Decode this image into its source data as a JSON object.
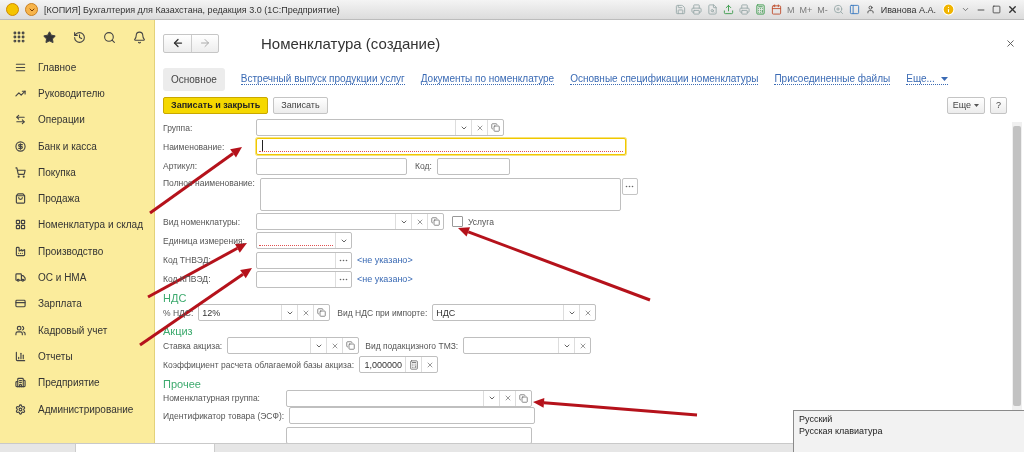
{
  "window": {
    "title": "[КОПИЯ] Бухгалтерия для Казахстана, редакция 3.0  (1С:Предприятие)",
    "memory_buttons": [
      "M",
      "M+",
      "M-"
    ],
    "user": "Иванова А.А."
  },
  "sidebar": {
    "items": [
      "Главное",
      "Руководителю",
      "Операции",
      "Банк и касса",
      "Покупка",
      "Продажа",
      "Номенклатура и склад",
      "Производство",
      "ОС и НМА",
      "Зарплата",
      "Кадровый учет",
      "Отчеты",
      "Предприятие",
      "Администрирование"
    ]
  },
  "form": {
    "title": "Номенклатура (создание)",
    "tabs": [
      {
        "label": "Основное",
        "selected": true
      },
      {
        "label": "Встречный выпуск продукции услуг",
        "selected": false
      },
      {
        "label": "Документы по номенклатуре",
        "selected": false
      },
      {
        "label": "Основные спецификации номенклатуры",
        "selected": false
      },
      {
        "label": "Присоединенные файлы",
        "selected": false
      }
    ],
    "tabs_more": "Еще...",
    "buttons": [
      {
        "label": "Записать и закрыть",
        "default": true
      },
      {
        "label": "Записать",
        "default": false
      }
    ],
    "more_button": "Еще",
    "help_button": "?"
  },
  "main_fields": [
    {
      "label": "Группа:",
      "kind": "ref"
    },
    {
      "label": "Наименование:",
      "kind": "text",
      "focused": true,
      "required": true
    },
    {
      "label": "Артикул:",
      "kind": "pair",
      "second_label": "Код:"
    },
    {
      "label": "Полное наименование:",
      "kind": "memo"
    },
    {
      "label": "Вид номенклатуры:",
      "kind": "ref",
      "checkbox": {
        "label": "Услуга",
        "checked": false
      }
    },
    {
      "label": "Единица измерения:",
      "kind": "select",
      "required": true
    },
    {
      "label": "Код ТНВЭД:",
      "kind": "classifier",
      "link": "<не указано>"
    },
    {
      "label": "Код КПВЭД:",
      "kind": "classifier",
      "link": "<не указано>"
    }
  ],
  "vat": {
    "heading": "НДС",
    "rate": {
      "label": "% НДС:",
      "value": "12%"
    },
    "import_kind": {
      "label": "Вид НДС при импорте:",
      "value": "НДС"
    }
  },
  "excise": {
    "heading": "Акциз",
    "rate": {
      "label": "Ставка акциза:"
    },
    "goods_kind": {
      "label": "Вид подакцизного ТМЗ:"
    },
    "coefficient": {
      "label": "Коэффициент расчета облагаемой базы акциза:",
      "value": "1,000000"
    }
  },
  "other": {
    "heading": "Прочее",
    "group": {
      "label": "Номенклатурная группа:"
    },
    "identifier": {
      "label": "Идентификатор товара (ЭСФ):"
    }
  },
  "tooltip": {
    "lines": [
      "Русский",
      "Русская клавиатура"
    ]
  }
}
